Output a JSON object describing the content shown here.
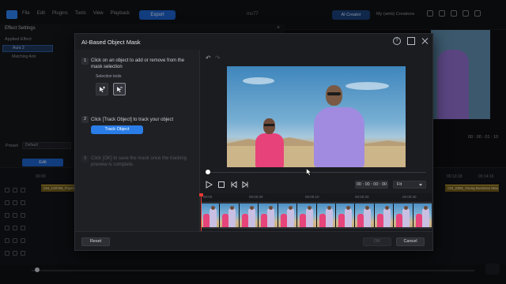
{
  "app": {
    "menu": [
      "File",
      "Edit",
      "Plugins",
      "Tools",
      "View",
      "Playback"
    ],
    "export_label": "Export",
    "project_name": "ms77",
    "ai_creator_label": "AI Creator",
    "my_creations_label": "My (amb) Creations"
  },
  "effect_settings": {
    "title": "Effect Settings",
    "applied_effect_label": "Applied Effect",
    "effects": [
      "Aura 2",
      "Matching Anti"
    ],
    "preset_label": "Preset",
    "preset_value": "Default",
    "edit_label": "Edit"
  },
  "timeline_bg": {
    "ruler_left": "00:00",
    "ruler_right_1": "00:13:18",
    "ruler_right_2": "00:14:16",
    "clip_left_label": "CM_128765_Poprider",
    "clip_right_label": "CM_2383_Young Business Man...",
    "right_timecode": "00 : 00 : 01 : 10"
  },
  "modal": {
    "title": "AI-Based Object Mask",
    "steps": [
      {
        "num": "1",
        "text": "Click on an object to add or remove from the mask selection"
      },
      {
        "num": "2",
        "text": "Click [Track Object] to track your object"
      },
      {
        "num": "3",
        "text": "Click [OK] to save the mask once the tracking preview is complete."
      }
    ],
    "selection_tools_label": "Selection tools",
    "track_button_label": "Track Object",
    "timecode": "00 : 00 : 00 : 00",
    "fit_value": "Fit",
    "ruler_ticks": [
      "00:00",
      "00:00:20",
      "00:00:10",
      "00:00:20",
      "00:00:30"
    ],
    "reset_label": "Reset",
    "ok_label": "OK",
    "cancel_label": "Cancel"
  },
  "colors": {
    "accent": "#2a7de6",
    "playhead": "#e53935"
  },
  "icons": {
    "help": "help-icon",
    "maximize": "maximize-icon",
    "close": "close-icon",
    "undo": "undo-icon",
    "redo": "redo-icon",
    "add_tool": "add-selection-icon",
    "remove_tool": "remove-selection-icon",
    "play": "play-icon",
    "stop": "stop-icon",
    "prev": "previous-frame-icon",
    "next": "next-frame-icon"
  }
}
